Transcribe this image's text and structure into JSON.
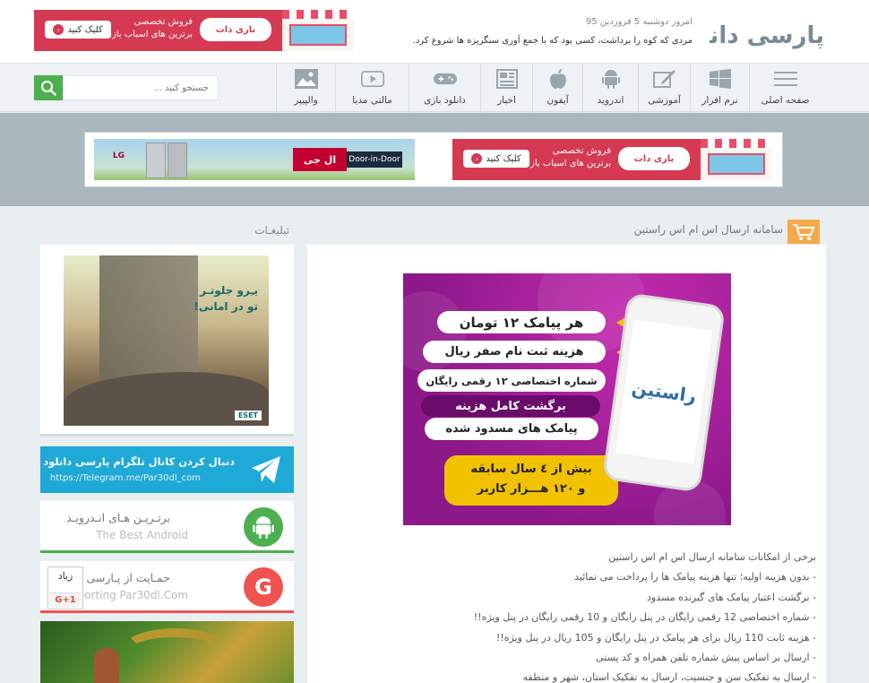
{
  "header": {
    "logo_text": "پارسی دانلود",
    "date": "امروز دوشنبه 5 فروردین 95",
    "quote": "مردی که کوه را برداشت، کسی بود که با جمع آوری سنگریزه ها شروع کرد."
  },
  "top_ad": {
    "line1": "فروش تخصصی",
    "line2": "برترین های اسباب بازی",
    "brand": "بازی دات",
    "button": "کلیک کنید"
  },
  "nav": {
    "items": [
      {
        "label": "صفحه اصلی",
        "icon": "menu-icon"
      },
      {
        "label": "نرم افزار",
        "icon": "windows-icon"
      },
      {
        "label": "آموزشی",
        "icon": "edit-icon"
      },
      {
        "label": "اندروید",
        "icon": "android-icon"
      },
      {
        "label": "آیفون",
        "icon": "apple-icon"
      },
      {
        "label": "اخبار",
        "icon": "news-icon"
      },
      {
        "label": "دانلود بازی",
        "icon": "gamepad-icon"
      },
      {
        "label": "مالتی مدیا",
        "icon": "play-icon"
      },
      {
        "label": "والپیپر",
        "icon": "image-icon"
      }
    ],
    "search_placeholder": "جستجو کنید ..."
  },
  "banners": {
    "lg_brand": "ال جی",
    "lg_slogan": "Door-in-Door",
    "lg_logo": "LG",
    "toy_line1": "فروش تخصصی",
    "toy_line2": "برترین های اسباب بازی",
    "toy_brand": "بازی دات",
    "toy_button": "کلیک کنید"
  },
  "post": {
    "title": "سامانه ارسال اس ام اس راستین",
    "promo": {
      "line1": "هر پیامک ۱۲ تومان",
      "line2": "هزینه ثبت نام صفر ریال",
      "line3": "شماره اختصاصی ۱۲ رقمی رایگان",
      "line4": "برگشت کامل هزینه",
      "line5": "پیامک های مسدود شده",
      "line6": "بیش از ٤ سال سابقه",
      "line7": "و ۱۲۰ هـــزار کاربر",
      "phone_logo": "راستین"
    },
    "body": [
      "برخی از امکانات سامانه ارسال اس ام اس راستین",
      "- بدون هزینه اولیه؛ تنها هزینه پیامک ها را پرداخت می نمائید",
      "- برگشت اعتبار پیامک های گیرنده مسدود",
      "- شماره اختصاصی 12 رقمی رایگان در پنل رایگان و 10 رقمی رایگان در پنل ویژه!!",
      "- هزینه ثابت 110 ریال برای هر پیامک در پنل رایگان و 105 ریال در پنل ویژه!!",
      "- ارسال بر اساس پیش شماره تلفن همراه و کد پستی",
      "- ارسال به تفکیک سن و جنسیت، ارسال به تفکیک استان، شهر و منطقه"
    ]
  },
  "sidebar": {
    "title": "تبلیغـات",
    "eset_tagline1": "یـِرو جلوتـر",
    "eset_tagline2": "تو در امانی!",
    "eset_brand": "ESET",
    "telegram_title": "دنبال کردن کانال تلگرام پارسی دانلود",
    "telegram_link": "https://Telegram.me/Par30dl_com",
    "android_title": "برتـریـن هـای انـدرویـد",
    "android_sub": "The Best Android",
    "support_title": "حمـایت از پـارسی دانـلود",
    "support_sub": "Supporting Par30dl.Com",
    "gplus_count": "زیاد",
    "gplus_label": "G+1"
  },
  "colors": {
    "accent_green": "#4caf50",
    "telegram_blue": "#1fa9d6",
    "support_red": "#ef5350",
    "ad_red": "#d53a52",
    "cart_orange": "#f7a94a"
  }
}
